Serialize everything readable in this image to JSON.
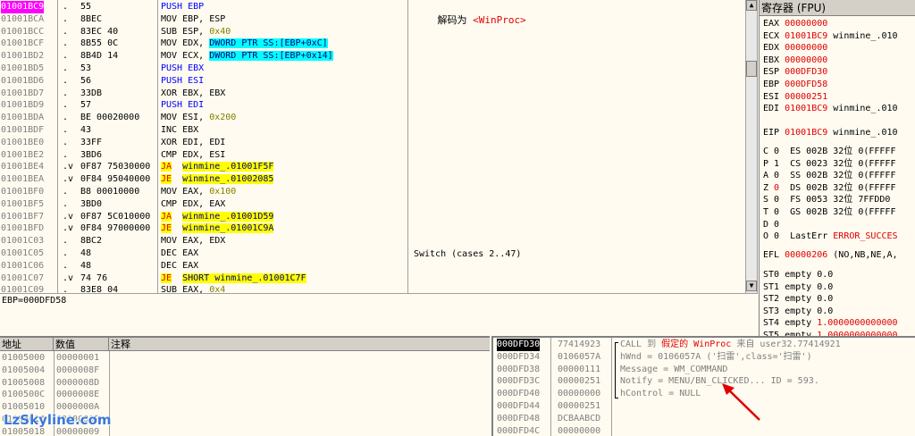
{
  "disasm": {
    "decoded_label": "解码为",
    "decoded_value": "<WinProc>",
    "switch_comment": "Switch (cases 2..47)",
    "rows": [
      {
        "addr": "01001BC9",
        "mark": ".",
        "hex": "55",
        "m": "PUSH",
        "o": "EBP",
        "k": "push",
        "sel": true
      },
      {
        "addr": "01001BCA",
        "mark": ".",
        "hex": "8BEC",
        "m": "MOV",
        "o": "EBP, ESP",
        "k": "mov"
      },
      {
        "addr": "01001BCC",
        "mark": ".",
        "hex": "83EC 40",
        "m": "SUB",
        "o": "ESP, ",
        "imm": "0x40",
        "k": "sub"
      },
      {
        "addr": "01001BCF",
        "mark": ".",
        "hex": "8B55 0C",
        "m": "MOV",
        "o": "EDX, ",
        "mem": "DWORD PTR SS:[EBP+0xC]",
        "k": "mov"
      },
      {
        "addr": "01001BD2",
        "mark": ".",
        "hex": "8B4D 14",
        "m": "MOV",
        "o": "ECX, ",
        "mem": "DWORD PTR SS:[EBP+0x14]",
        "k": "mov"
      },
      {
        "addr": "01001BD5",
        "mark": ".",
        "hex": "53",
        "m": "PUSH",
        "o": "EBX",
        "k": "push"
      },
      {
        "addr": "01001BD6",
        "mark": ".",
        "hex": "56",
        "m": "PUSH",
        "o": "ESI",
        "k": "push"
      },
      {
        "addr": "01001BD7",
        "mark": ".",
        "hex": "33DB",
        "m": "XOR",
        "o": "EBX, EBX",
        "k": "mov"
      },
      {
        "addr": "01001BD9",
        "mark": ".",
        "hex": "57",
        "m": "PUSH",
        "o": "EDI",
        "k": "push"
      },
      {
        "addr": "01001BDA",
        "mark": ".",
        "hex": "BE 00020000",
        "m": "MOV",
        "o": "ESI, ",
        "imm": "0x200",
        "k": "mov"
      },
      {
        "addr": "01001BDF",
        "mark": ".",
        "hex": "43",
        "m": "INC",
        "o": "EBX",
        "k": "mov"
      },
      {
        "addr": "01001BE0",
        "mark": ".",
        "hex": "33FF",
        "m": "XOR",
        "o": "EDI, EDI",
        "k": "mov"
      },
      {
        "addr": "01001BE2",
        "mark": ".",
        "hex": "3BD6",
        "m": "CMP",
        "o": "EDX, ESI",
        "k": "mov"
      },
      {
        "addr": "01001BE4",
        "mark": ".v",
        "hex": "0F87 75030000",
        "m": "JA",
        "o": "winmine_.01001F5F",
        "k": "jmp"
      },
      {
        "addr": "01001BEA",
        "mark": ".v",
        "hex": "0F84 95040000",
        "m": "JE",
        "o": "winmine_.01002085",
        "k": "jmp"
      },
      {
        "addr": "01001BF0",
        "mark": ".",
        "hex": "B8 00010000",
        "m": "MOV",
        "o": "EAX, ",
        "imm": "0x100",
        "k": "mov"
      },
      {
        "addr": "01001BF5",
        "mark": ".",
        "hex": "3BD0",
        "m": "CMP",
        "o": "EDX, EAX",
        "k": "mov"
      },
      {
        "addr": "01001BF7",
        "mark": ".v",
        "hex": "0F87 5C010000",
        "m": "JA",
        "o": "winmine_.01001D59",
        "k": "jmp"
      },
      {
        "addr": "01001BFD",
        "mark": ".v",
        "hex": "0F84 97000000",
        "m": "JE",
        "o": "winmine_.01001C9A",
        "k": "jmp"
      },
      {
        "addr": "01001C03",
        "mark": ".",
        "hex": "8BC2",
        "m": "MOV",
        "o": "EAX, EDX",
        "k": "mov"
      },
      {
        "addr": "01001C05",
        "mark": ".",
        "hex": "48",
        "m": "DEC",
        "o": "EAX",
        "k": "mov",
        "cmt": true
      },
      {
        "addr": "01001C06",
        "mark": ".",
        "hex": "48",
        "m": "DEC",
        "o": "EAX",
        "k": "mov"
      },
      {
        "addr": "01001C07",
        "mark": ".v",
        "hex": "74 76",
        "m": "JE",
        "o": "SHORT winmine_.01001C7F",
        "k": "jmp"
      },
      {
        "addr": "01001C09",
        "mark": ".",
        "hex": "83E8 04",
        "m": "SUB",
        "o": "EAX, ",
        "imm": "0x4",
        "k": "sub"
      }
    ]
  },
  "info": {
    "text": "EBP=000DFD58"
  },
  "regs": {
    "title": "寄存器 (FPU)",
    "lines": [
      [
        {
          "t": "EAX "
        },
        {
          "t": "00000000",
          "c": "red"
        }
      ],
      [
        {
          "t": "ECX "
        },
        {
          "t": "01001BC9",
          "c": "red"
        },
        {
          "t": " winmine_.010"
        }
      ],
      [
        {
          "t": "EDX "
        },
        {
          "t": "00000000",
          "c": "red"
        }
      ],
      [
        {
          "t": "EBX "
        },
        {
          "t": "00000000",
          "c": "red"
        }
      ],
      [
        {
          "t": "ESP "
        },
        {
          "t": "000DFD30",
          "c": "red"
        }
      ],
      [
        {
          "t": "EBP "
        },
        {
          "t": "000DFD58",
          "c": "red"
        }
      ],
      [
        {
          "t": "ESI "
        },
        {
          "t": "00000251",
          "c": "red"
        }
      ],
      [
        {
          "t": "EDI "
        },
        {
          "t": "01001BC9",
          "c": "red"
        },
        {
          "t": " winmine_.010"
        }
      ],
      [
        {
          "t": ""
        }
      ],
      [
        {
          "t": "EIP "
        },
        {
          "t": "01001BC9",
          "c": "red"
        },
        {
          "t": " winmine_.010"
        }
      ],
      [
        {
          "t": ""
        }
      ],
      [
        {
          "t": "C 0  ES 002B 32位 0(FFFFF"
        }
      ],
      [
        {
          "t": "P 1  CS 0023 32位 0(FFFFF"
        }
      ],
      [
        {
          "t": "A 0  SS 002B 32位 0(FFFFF"
        }
      ],
      [
        {
          "t": "Z "
        },
        {
          "t": "0",
          "c": "red"
        },
        {
          "t": "  DS 002B 32位 0(FFFFF"
        }
      ],
      [
        {
          "t": "S 0  FS 0053 32位 7FFDD0"
        }
      ],
      [
        {
          "t": "T 0  GS 002B 32位 0(FFFFF"
        }
      ],
      [
        {
          "t": "D 0"
        }
      ],
      [
        {
          "t": "O 0  LastErr "
        },
        {
          "t": "ERROR_SUCCES",
          "c": "red"
        }
      ],
      [
        {
          "t": ""
        }
      ],
      [
        {
          "t": "EFL "
        },
        {
          "t": "00000206",
          "c": "red"
        },
        {
          "t": " (NO,NB,NE,A,"
        }
      ],
      [
        {
          "t": ""
        }
      ],
      [
        {
          "t": "ST0 empty 0.0"
        }
      ],
      [
        {
          "t": "ST1 empty 0.0"
        }
      ],
      [
        {
          "t": "ST2 empty 0.0"
        }
      ],
      [
        {
          "t": "ST3 empty 0.0"
        }
      ],
      [
        {
          "t": "ST4 empty "
        },
        {
          "t": "1.0000000000000",
          "c": "red"
        }
      ],
      [
        {
          "t": "ST5 empty "
        },
        {
          "t": "1.0000000000000",
          "c": "red"
        }
      ]
    ]
  },
  "dump": {
    "headers": [
      "地址",
      "数值",
      "注释"
    ],
    "rows": [
      [
        "01005000",
        "00000001"
      ],
      [
        "01005004",
        "0000008F"
      ],
      [
        "01005008",
        "0000008D"
      ],
      [
        "0100500C",
        "0000008E"
      ],
      [
        "01005010",
        "0000000A"
      ],
      [
        "01005014",
        "00000009"
      ],
      [
        "01005018",
        "00000009"
      ]
    ]
  },
  "stack": {
    "rows": [
      {
        "a": "000DFD30",
        "v": "77414923",
        "sel": true,
        "c": [
          {
            "t": "CALL 到 ",
            "cls": "gray"
          },
          {
            "t": "假定的 ",
            "cls": "red"
          },
          {
            "t": "WinProc",
            "cls": "red"
          },
          {
            "t": " 来自 user32.77414921",
            "cls": "gray"
          }
        ]
      },
      {
        "a": "000DFD34",
        "v": "0106057A",
        "c": [
          {
            "t": "hWnd = 0106057A ('扫雷',class='扫雷')",
            "cls": "gray"
          }
        ]
      },
      {
        "a": "000DFD38",
        "v": "00000111",
        "c": [
          {
            "t": "Message = WM_COMMAND",
            "cls": "gray"
          }
        ]
      },
      {
        "a": "000DFD3C",
        "v": "00000251",
        "c": [
          {
            "t": "Notify = MENU/BN_CLICKED... ID = 593.",
            "cls": "gray"
          }
        ]
      },
      {
        "a": "000DFD40",
        "v": "00000000",
        "c": [
          {
            "t": "hControl = NULL",
            "cls": "gray"
          }
        ]
      },
      {
        "a": "000DFD44",
        "v": "00000251",
        "c": []
      },
      {
        "a": "000DFD48",
        "v": "DCBAABCD",
        "c": []
      },
      {
        "a": "000DFD4C",
        "v": "00000000",
        "c": []
      }
    ]
  },
  "watermark": "LzSkyline.com"
}
